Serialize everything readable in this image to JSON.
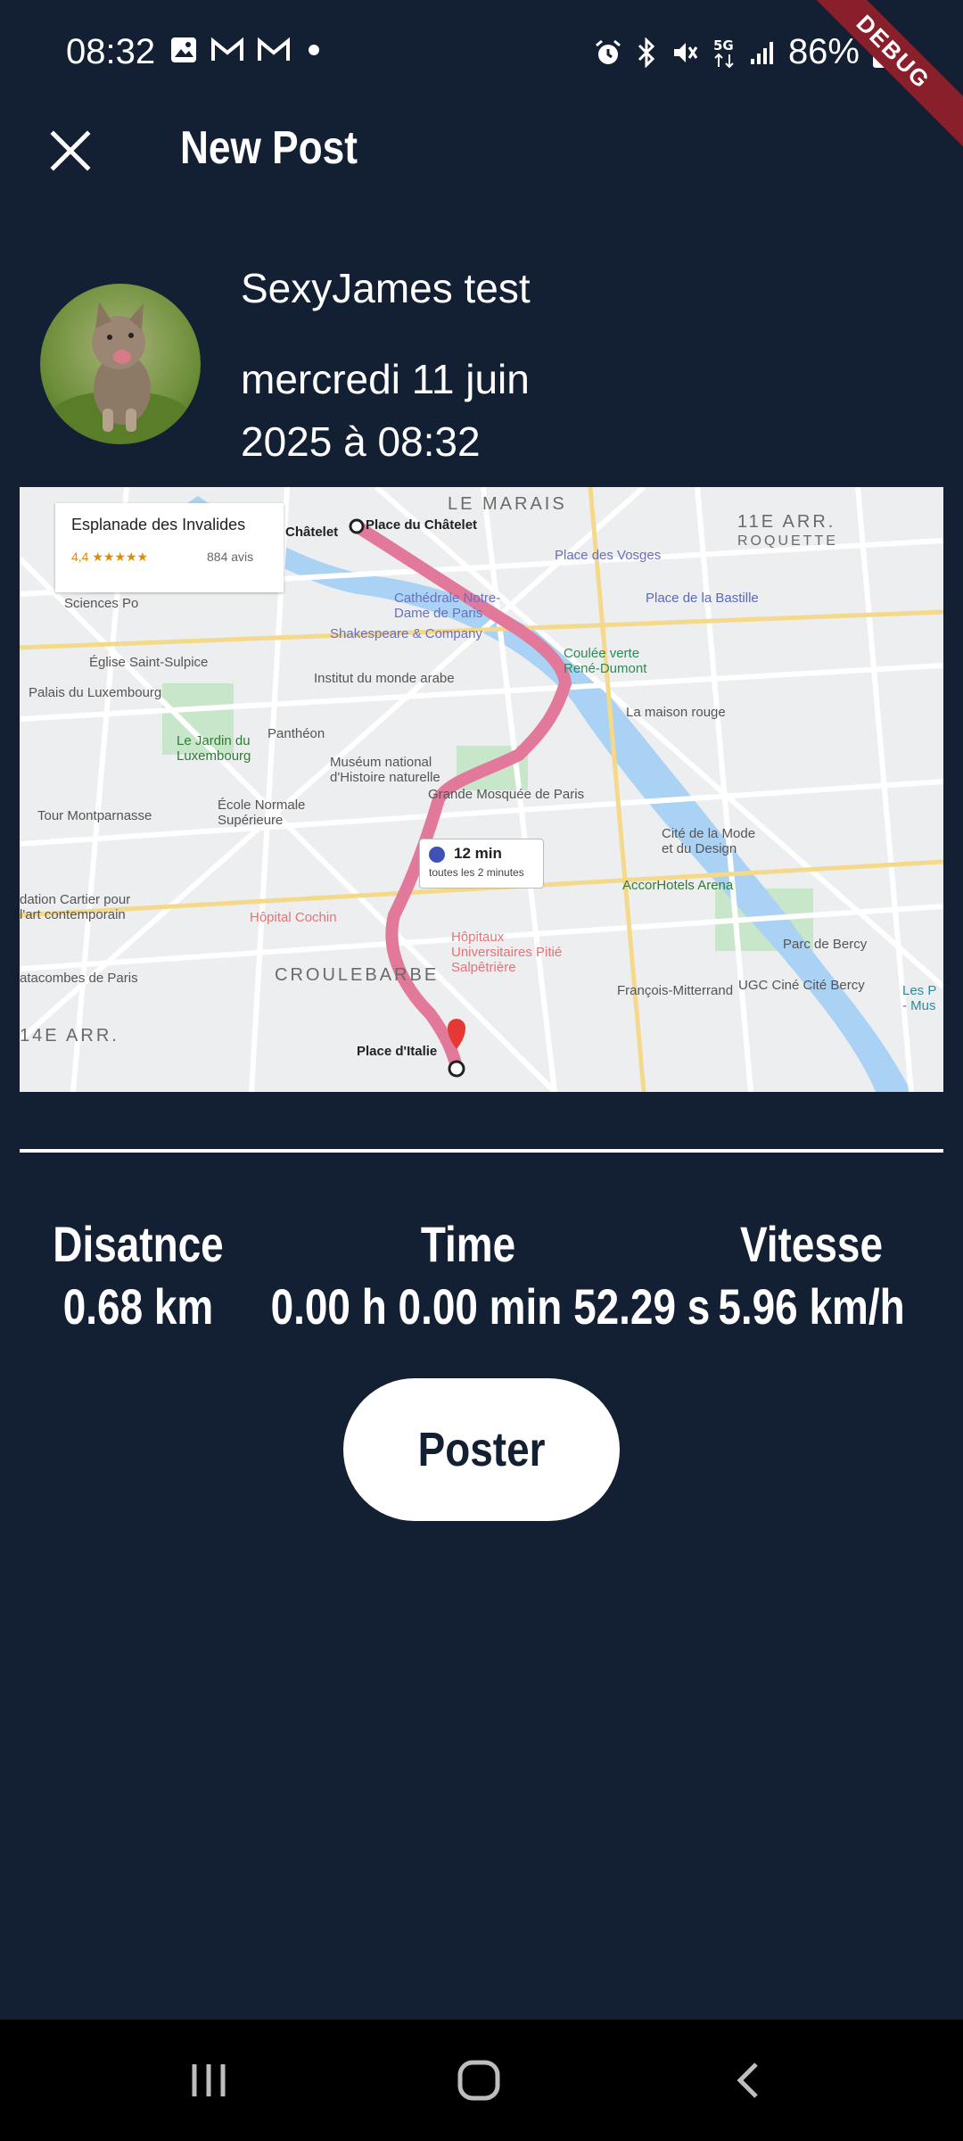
{
  "status_bar": {
    "time": "08:32",
    "battery": "86%",
    "debug_label": "DEBUG",
    "icons": [
      "gallery-icon",
      "gmail-icon",
      "gmail-icon",
      "dot-icon",
      "alarm-icon",
      "bluetooth-icon",
      "mute-icon",
      "5g-icon",
      "signal-icon",
      "battery-icon"
    ]
  },
  "app_bar": {
    "title": "New Post",
    "close_icon": "close-icon"
  },
  "post": {
    "author": "SexyJames test",
    "date": "mercredi 11 juin 2025 à 08:32"
  },
  "map": {
    "place_card": {
      "title": "Esplanade des Invalides",
      "rating": "4,4 ★★★★★",
      "reviews": "884 avis"
    },
    "duration": {
      "main": "12 min",
      "sub": "toutes les 2 minutes"
    },
    "labels": {
      "marais": "LE MARAIS",
      "arr11": "11E ARR.",
      "roquette": "ROQUETTE",
      "chatelet": "Châtelet",
      "place_chatelet": "Place du Châtelet",
      "place_vosges": "Place des Vosges",
      "bastille": "Place de la Bastille",
      "notre_dame": "Cathédrale Notre-Dame de Paris",
      "shakespeare": "Shakespeare & Company",
      "saint_sulpice": "Église Saint-Sulpice",
      "institut": "Institut du monde arabe",
      "coulee": "Coulée verte René-Dumont",
      "luxembourg": "Palais du Luxembourg",
      "pantheon": "Panthéon",
      "jardin": "Le Jardin du Luxembourg",
      "museum": "Muséum national d'Histoire naturelle",
      "maison_rouge": "La maison rouge",
      "mosquee": "Grande Mosquée de Paris",
      "montparnasse": "Tour Montparnasse",
      "ecole": "École Normale Supérieure",
      "cite_mode": "Cité de la Mode et du Design",
      "accor": "AccorHotels Arena",
      "cartier": "dation Cartier pour l'art contemporain",
      "cochin": "Hôpital Cochin",
      "pitie": "Hôpitaux Universitaires Pitié Salpêtrière",
      "bercy": "Parc de Bercy",
      "catacombes": "atacombes de Paris",
      "croulebarbe": "CROULEBARBE",
      "mitterrand": "François-Mitterrand",
      "ugc": "UGC Ciné Cité Bercy",
      "arr14": "14E ARR.",
      "italie": "Place d'Italie",
      "sciences": "Sciences Po",
      "les_p": "Les P - Mus"
    }
  },
  "stats": {
    "distance_label": "Disatnce",
    "distance_value": "0.68 km",
    "time_label": "Time",
    "time_value": "0.00 h 0.00 min 52.29 s",
    "speed_label": "Vitesse",
    "speed_value": "5.96 km/h"
  },
  "actions": {
    "post_button": "Poster"
  },
  "nav_bar": {
    "icons": [
      "recent-apps-icon",
      "home-icon",
      "back-icon"
    ]
  }
}
